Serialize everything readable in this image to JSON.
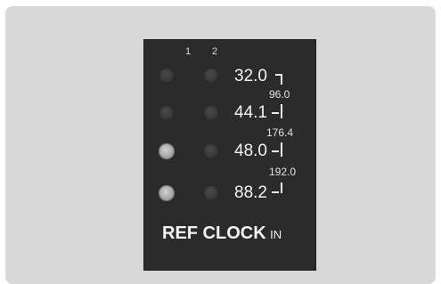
{
  "panel": {
    "columns": [
      "1",
      "2"
    ],
    "rates": [
      "32.0",
      "44.1",
      "48.0",
      "88.2"
    ],
    "combined_rates": [
      "96.0",
      "176.4",
      "192.0"
    ],
    "leds": [
      {
        "col1": "off",
        "col2": "off"
      },
      {
        "col1": "off",
        "col2": "off"
      },
      {
        "col1": "on",
        "col2": "off"
      },
      {
        "col1": "on",
        "col2": "off"
      }
    ],
    "label_main": "REF CLOCK",
    "label_sub": "IN"
  }
}
